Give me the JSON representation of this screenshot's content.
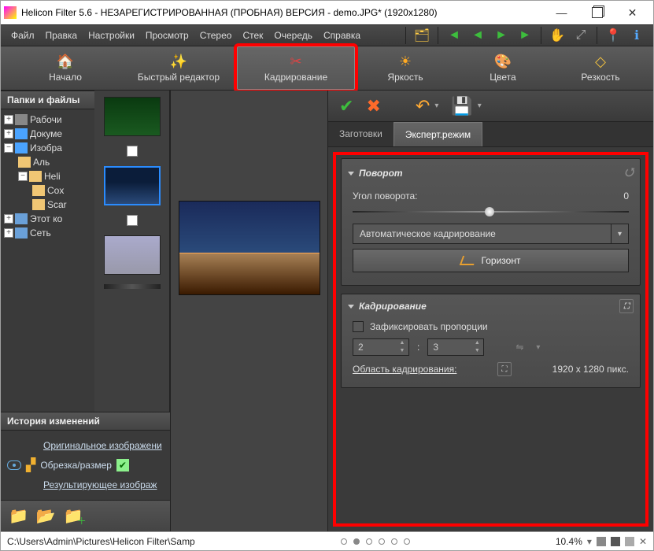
{
  "titlebar": {
    "title": "Helicon Filter 5.6 - НЕЗАРЕГИСТРИРОВАННАЯ (ПРОБНАЯ) ВЕРСИЯ - demo.JPG* (1920x1280)"
  },
  "winbtns": {
    "min": "—",
    "close": "✕"
  },
  "menu": {
    "file": "Файл",
    "edit": "Правка",
    "settings": "Настройки",
    "view": "Просмотр",
    "stereo": "Стерео",
    "stack": "Стек",
    "queue": "Очередь",
    "help": "Справка"
  },
  "topicons": {
    "folders": "folders-icon",
    "back": "◄",
    "back2": "◄",
    "fwd": "►",
    "fwd2": "►",
    "hand": "✋",
    "zoomfit": "⤢",
    "pin": "📍",
    "info": "ℹ"
  },
  "modes": {
    "start": {
      "label": "Начало",
      "icon": "🏠"
    },
    "quick": {
      "label": "Быстрый редактор",
      "icon": "✨"
    },
    "crop": {
      "label": "Кадрирование",
      "icon": "✂"
    },
    "bright": {
      "label": "Яркость",
      "icon": "☀"
    },
    "color": {
      "label": "Цвета",
      "icon": "🎨"
    },
    "sharp": {
      "label": "Резкость",
      "icon": "◇"
    }
  },
  "left": {
    "folders_hdr": "Папки и файлы",
    "history_hdr": "История изменений",
    "tree": {
      "n0": "Рабочи",
      "n1": "Докуме",
      "n2": "Изобра",
      "n3": "Аль",
      "n4": "Heli",
      "n5": "Cox",
      "n6": "Scar",
      "n7": "Этот ко",
      "n8": "Сеть"
    },
    "history": {
      "orig": "Оригинальное изображени",
      "crop": "Обрезка/размер",
      "result": "Результирующее изображ"
    }
  },
  "right": {
    "toolbar": {
      "ok": "✔",
      "cancel": "✖",
      "undo": "↶",
      "save": "💾"
    },
    "tabs": {
      "presets": "Заготовки",
      "expert": "Эксперт.режим"
    },
    "rotate": {
      "hdr": "Поворот",
      "angle_label": "Угол поворота:",
      "angle_value": "0",
      "auto": "Автоматическое кадрирование",
      "horizon": "Горизонт"
    },
    "crop": {
      "hdr": "Кадрирование",
      "fix": "Зафиксировать пропорции",
      "w": "2",
      "sep": ":",
      "h": "3",
      "area_label": "Область кадрирования:",
      "area_val": "1920 x 1280 пикс."
    }
  },
  "status": {
    "path": "C:\\Users\\Admin\\Pictures\\Helicon Filter\\Samp",
    "zoom": "10.4%"
  },
  "colors": {
    "hl": "#ff0000"
  }
}
